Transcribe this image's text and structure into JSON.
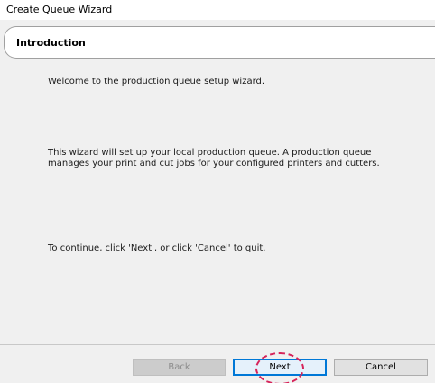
{
  "window": {
    "title": "Create Queue Wizard"
  },
  "header": {
    "title": "Introduction"
  },
  "content": {
    "paragraphs": [
      "Welcome to the production queue setup wizard.",
      "This wizard will set up your local production queue. A production queue manages your print and cut jobs for your configured printers and cutters.",
      "To continue, click 'Next', or click 'Cancel' to quit."
    ]
  },
  "buttons": {
    "back": {
      "label": "Back",
      "enabled": false
    },
    "next": {
      "label": "Next",
      "enabled": true,
      "focused": true
    },
    "cancel": {
      "label": "Cancel",
      "enabled": true
    }
  },
  "colors": {
    "accent": "#0078d7",
    "highlight": "#d6245a",
    "panel": "#f0f0f0"
  }
}
